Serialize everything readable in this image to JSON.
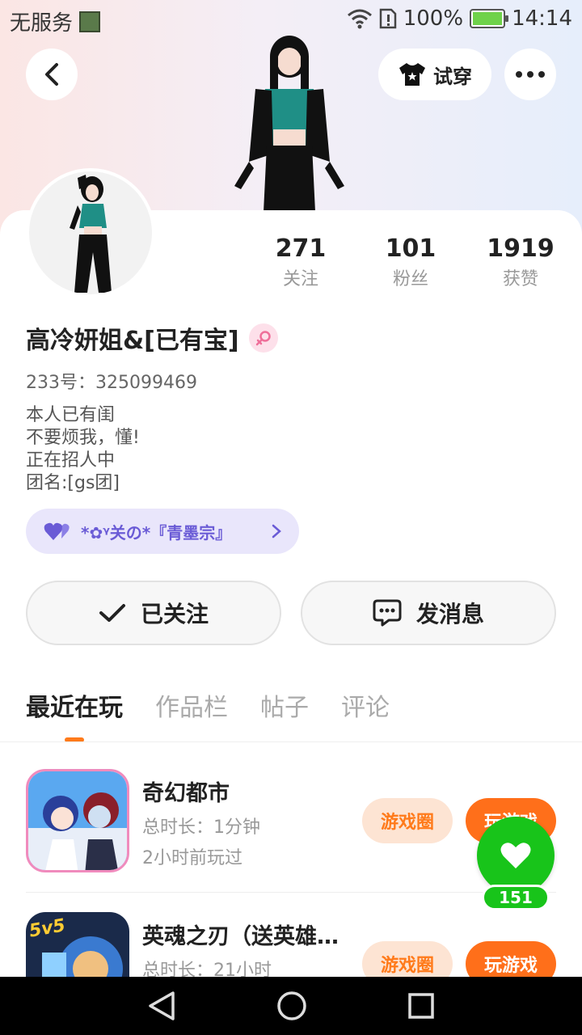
{
  "status_bar": {
    "carrier": "无服务",
    "battery": "100%",
    "time": "14:14"
  },
  "header": {
    "try_on_label": "试穿"
  },
  "profile": {
    "stats": [
      {
        "value": "271",
        "label": "关注"
      },
      {
        "value": "101",
        "label": "粉丝"
      },
      {
        "value": "1919",
        "label": "获赞"
      }
    ],
    "nickname": "高冷妍姐&[已有宝]",
    "uid": "233号：325099469",
    "bio": [
      "本人已有闺",
      "不要烦我，懂!",
      "正在招人中",
      "团名:[gs团]"
    ],
    "guild_name": "*✿ᵞ关の*『青墨宗』"
  },
  "actions": {
    "follow_label": "已关注",
    "message_label": "发消息"
  },
  "tabs": [
    "最近在玩",
    "作品栏",
    "帖子",
    "评论"
  ],
  "games": [
    {
      "title": "奇幻都市",
      "duration": "总时长：1分钟",
      "last_played": "2小时前玩过",
      "circle_label": "游戏圈",
      "play_label": "玩游戏"
    },
    {
      "title": "英魂之刃（送英雄…",
      "duration": "总时长：21小时",
      "circle_label": "游戏圈",
      "play_label": "玩游戏",
      "badge": "5v5"
    }
  ],
  "like_fab": {
    "count": "151"
  },
  "colors": {
    "accent": "#ff7a1a",
    "like_green": "#18c41a",
    "guild_purple": "#6a5bd6"
  }
}
